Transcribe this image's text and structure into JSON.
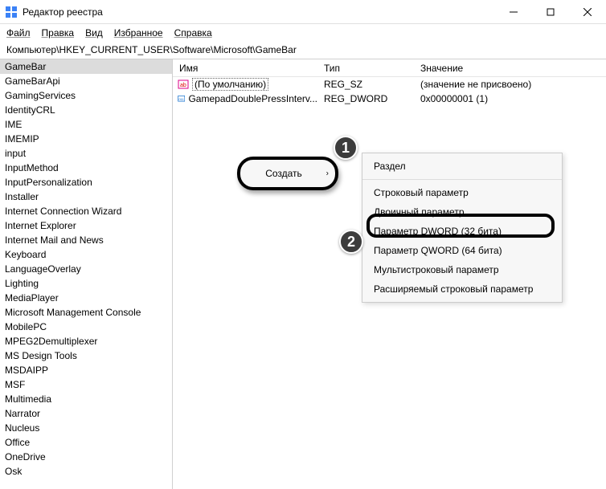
{
  "window": {
    "title": "Редактор реестра"
  },
  "menu": {
    "file": "Файл",
    "edit": "Правка",
    "view": "Вид",
    "favorites": "Избранное",
    "help": "Справка"
  },
  "address": "Компьютер\\HKEY_CURRENT_USER\\Software\\Microsoft\\GameBar",
  "tree": {
    "items": [
      "GameBar",
      "GameBarApi",
      "GamingServices",
      "IdentityCRL",
      "IME",
      "IMEMIP",
      "input",
      "InputMethod",
      "InputPersonalization",
      "Installer",
      "Internet Connection Wizard",
      "Internet Explorer",
      "Internet Mail and News",
      "Keyboard",
      "LanguageOverlay",
      "Lighting",
      "MediaPlayer",
      "Microsoft Management Console",
      "MobilePC",
      "MPEG2Demultiplexer",
      "MS Design Tools",
      "MSDAIPP",
      "MSF",
      "Multimedia",
      "Narrator",
      "Nucleus",
      "Office",
      "OneDrive",
      "Osk"
    ],
    "selected_index": 0
  },
  "list": {
    "headers": {
      "name": "Имя",
      "type": "Тип",
      "value": "Значение"
    },
    "rows": [
      {
        "name": "(По умолчанию)",
        "type": "REG_SZ",
        "value": "(значение не присвоено)",
        "iconKind": "sz",
        "selected": true
      },
      {
        "name": "GamepadDoublePressInterv...",
        "type": "REG_DWORD",
        "value": "0x00000001 (1)",
        "iconKind": "dword",
        "selected": false
      }
    ]
  },
  "context1": {
    "create_label": "Создать"
  },
  "context2": {
    "items": [
      {
        "label": "Раздел"
      },
      {
        "sep": true
      },
      {
        "label": "Строковый параметр"
      },
      {
        "label": "Двоичный параметр"
      },
      {
        "label": "Параметр DWORD (32 бита)"
      },
      {
        "label": "Параметр QWORD (64 бита)"
      },
      {
        "label": "Мультистроковый параметр"
      },
      {
        "label": "Расширяемый строковый параметр"
      }
    ]
  },
  "badges": {
    "one": "1",
    "two": "2"
  }
}
